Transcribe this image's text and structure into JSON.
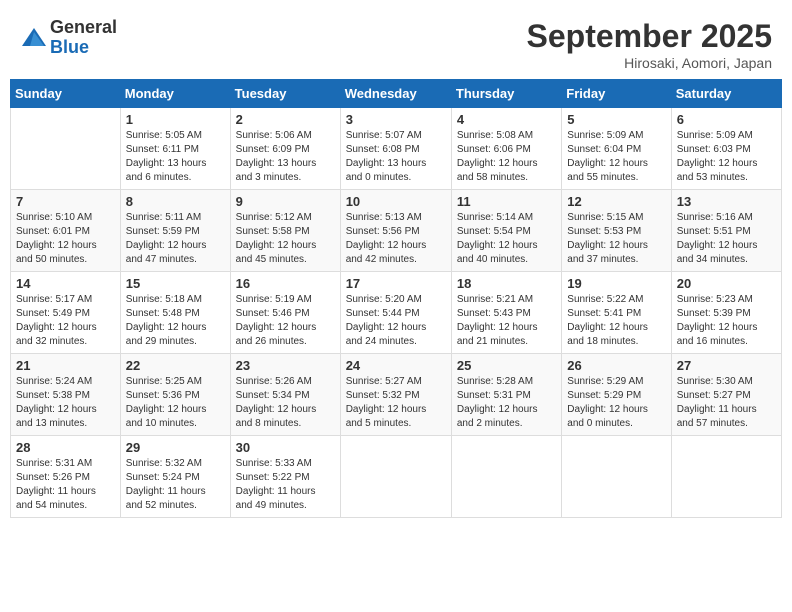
{
  "header": {
    "logo_general": "General",
    "logo_blue": "Blue",
    "month_title": "September 2025",
    "location": "Hirosaki, Aomori, Japan"
  },
  "weekdays": [
    "Sunday",
    "Monday",
    "Tuesday",
    "Wednesday",
    "Thursday",
    "Friday",
    "Saturday"
  ],
  "weeks": [
    [
      {
        "day": "",
        "content": ""
      },
      {
        "day": "1",
        "content": "Sunrise: 5:05 AM\nSunset: 6:11 PM\nDaylight: 13 hours\nand 6 minutes."
      },
      {
        "day": "2",
        "content": "Sunrise: 5:06 AM\nSunset: 6:09 PM\nDaylight: 13 hours\nand 3 minutes."
      },
      {
        "day": "3",
        "content": "Sunrise: 5:07 AM\nSunset: 6:08 PM\nDaylight: 13 hours\nand 0 minutes."
      },
      {
        "day": "4",
        "content": "Sunrise: 5:08 AM\nSunset: 6:06 PM\nDaylight: 12 hours\nand 58 minutes."
      },
      {
        "day": "5",
        "content": "Sunrise: 5:09 AM\nSunset: 6:04 PM\nDaylight: 12 hours\nand 55 minutes."
      },
      {
        "day": "6",
        "content": "Sunrise: 5:09 AM\nSunset: 6:03 PM\nDaylight: 12 hours\nand 53 minutes."
      }
    ],
    [
      {
        "day": "7",
        "content": "Sunrise: 5:10 AM\nSunset: 6:01 PM\nDaylight: 12 hours\nand 50 minutes."
      },
      {
        "day": "8",
        "content": "Sunrise: 5:11 AM\nSunset: 5:59 PM\nDaylight: 12 hours\nand 47 minutes."
      },
      {
        "day": "9",
        "content": "Sunrise: 5:12 AM\nSunset: 5:58 PM\nDaylight: 12 hours\nand 45 minutes."
      },
      {
        "day": "10",
        "content": "Sunrise: 5:13 AM\nSunset: 5:56 PM\nDaylight: 12 hours\nand 42 minutes."
      },
      {
        "day": "11",
        "content": "Sunrise: 5:14 AM\nSunset: 5:54 PM\nDaylight: 12 hours\nand 40 minutes."
      },
      {
        "day": "12",
        "content": "Sunrise: 5:15 AM\nSunset: 5:53 PM\nDaylight: 12 hours\nand 37 minutes."
      },
      {
        "day": "13",
        "content": "Sunrise: 5:16 AM\nSunset: 5:51 PM\nDaylight: 12 hours\nand 34 minutes."
      }
    ],
    [
      {
        "day": "14",
        "content": "Sunrise: 5:17 AM\nSunset: 5:49 PM\nDaylight: 12 hours\nand 32 minutes."
      },
      {
        "day": "15",
        "content": "Sunrise: 5:18 AM\nSunset: 5:48 PM\nDaylight: 12 hours\nand 29 minutes."
      },
      {
        "day": "16",
        "content": "Sunrise: 5:19 AM\nSunset: 5:46 PM\nDaylight: 12 hours\nand 26 minutes."
      },
      {
        "day": "17",
        "content": "Sunrise: 5:20 AM\nSunset: 5:44 PM\nDaylight: 12 hours\nand 24 minutes."
      },
      {
        "day": "18",
        "content": "Sunrise: 5:21 AM\nSunset: 5:43 PM\nDaylight: 12 hours\nand 21 minutes."
      },
      {
        "day": "19",
        "content": "Sunrise: 5:22 AM\nSunset: 5:41 PM\nDaylight: 12 hours\nand 18 minutes."
      },
      {
        "day": "20",
        "content": "Sunrise: 5:23 AM\nSunset: 5:39 PM\nDaylight: 12 hours\nand 16 minutes."
      }
    ],
    [
      {
        "day": "21",
        "content": "Sunrise: 5:24 AM\nSunset: 5:38 PM\nDaylight: 12 hours\nand 13 minutes."
      },
      {
        "day": "22",
        "content": "Sunrise: 5:25 AM\nSunset: 5:36 PM\nDaylight: 12 hours\nand 10 minutes."
      },
      {
        "day": "23",
        "content": "Sunrise: 5:26 AM\nSunset: 5:34 PM\nDaylight: 12 hours\nand 8 minutes."
      },
      {
        "day": "24",
        "content": "Sunrise: 5:27 AM\nSunset: 5:32 PM\nDaylight: 12 hours\nand 5 minutes."
      },
      {
        "day": "25",
        "content": "Sunrise: 5:28 AM\nSunset: 5:31 PM\nDaylight: 12 hours\nand 2 minutes."
      },
      {
        "day": "26",
        "content": "Sunrise: 5:29 AM\nSunset: 5:29 PM\nDaylight: 12 hours\nand 0 minutes."
      },
      {
        "day": "27",
        "content": "Sunrise: 5:30 AM\nSunset: 5:27 PM\nDaylight: 11 hours\nand 57 minutes."
      }
    ],
    [
      {
        "day": "28",
        "content": "Sunrise: 5:31 AM\nSunset: 5:26 PM\nDaylight: 11 hours\nand 54 minutes."
      },
      {
        "day": "29",
        "content": "Sunrise: 5:32 AM\nSunset: 5:24 PM\nDaylight: 11 hours\nand 52 minutes."
      },
      {
        "day": "30",
        "content": "Sunrise: 5:33 AM\nSunset: 5:22 PM\nDaylight: 11 hours\nand 49 minutes."
      },
      {
        "day": "",
        "content": ""
      },
      {
        "day": "",
        "content": ""
      },
      {
        "day": "",
        "content": ""
      },
      {
        "day": "",
        "content": ""
      }
    ]
  ]
}
